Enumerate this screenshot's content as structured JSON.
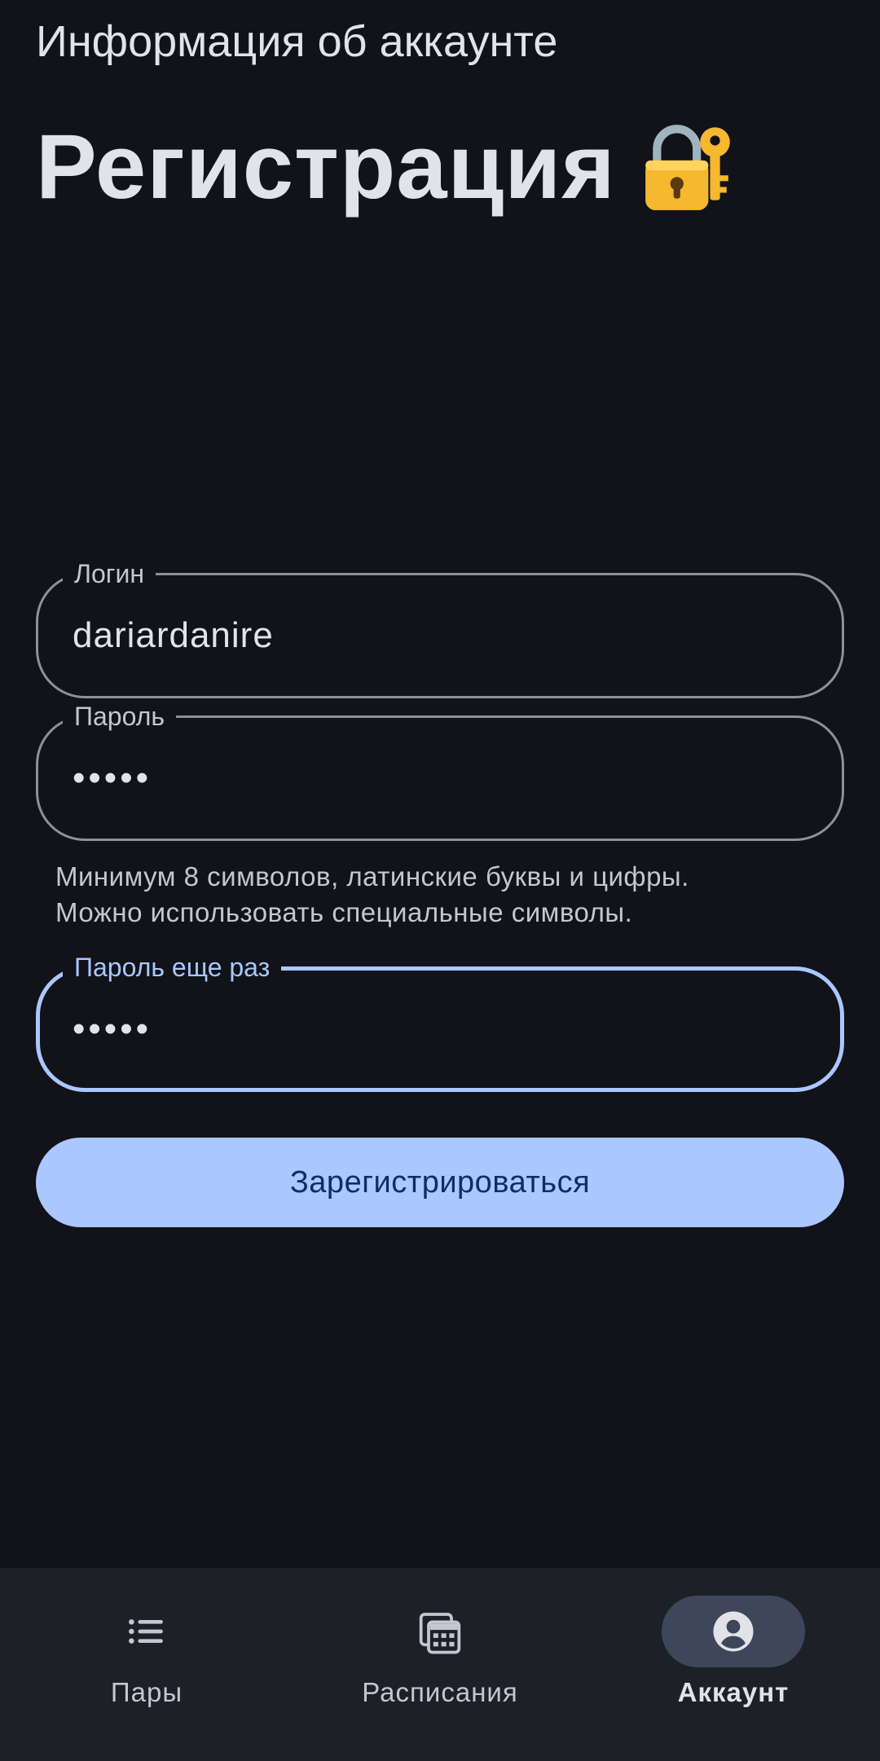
{
  "app_bar": {
    "title": "Информация об аккаунте"
  },
  "page": {
    "headline": "Регистрация",
    "headline_icon": "locked-with-key-icon"
  },
  "form": {
    "login": {
      "label": "Логин",
      "value": "dariardanire"
    },
    "password": {
      "label": "Пароль",
      "value": "•••••"
    },
    "hint": {
      "line1": "Минимум 8 символов, латинские буквы и цифры.",
      "line2": "Можно использовать специальные символы."
    },
    "password_repeat": {
      "label": "Пароль еще раз",
      "value": "•••••",
      "focused": true
    },
    "submit_label": "Зарегистрироваться"
  },
  "bottom_nav": {
    "items": [
      {
        "label": "Пары",
        "icon": "list-icon",
        "active": false
      },
      {
        "label": "Расписания",
        "icon": "calendar-icon",
        "active": false
      },
      {
        "label": "Аккаунт",
        "icon": "account-circle-icon",
        "active": true
      }
    ]
  },
  "colors": {
    "background": "#111319",
    "accent": "#aac7ff",
    "nav_background": "#1d2027",
    "active_pill": "#3e4759"
  }
}
